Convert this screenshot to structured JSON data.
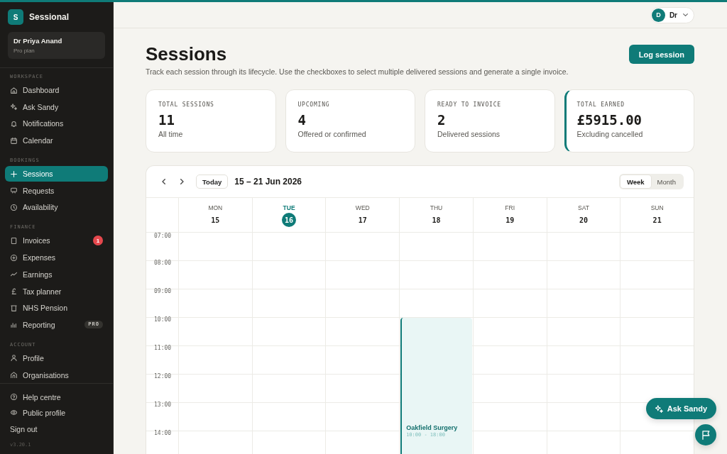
{
  "brand": {
    "logo_letter": "S",
    "name": "Sessional"
  },
  "account": {
    "name": "Dr Priya Anand",
    "plan": "Pro plan"
  },
  "sidebar": {
    "sections": [
      {
        "title": "WORKSPACE",
        "items": [
          {
            "label": "Dashboard",
            "selected": false
          },
          {
            "label": "Ask Sandy",
            "selected": false
          },
          {
            "label": "Notifications",
            "selected": false
          },
          {
            "label": "Calendar",
            "selected": false
          }
        ]
      },
      {
        "title": "BOOKINGS",
        "items": [
          {
            "label": "Sessions",
            "selected": true
          },
          {
            "label": "Requests",
            "selected": false
          },
          {
            "label": "Availability",
            "selected": false
          }
        ]
      },
      {
        "title": "FINANCE",
        "items": [
          {
            "label": "Invoices",
            "selected": false,
            "badge": "1"
          },
          {
            "label": "Expenses",
            "selected": false
          },
          {
            "label": "Earnings",
            "selected": false
          },
          {
            "label": "Tax planner",
            "selected": false
          },
          {
            "label": "NHS Pension",
            "selected": false
          },
          {
            "label": "Reporting",
            "selected": false,
            "tag": "PRO"
          }
        ]
      },
      {
        "title": "ACCOUNT",
        "items": [
          {
            "label": "Profile",
            "selected": false
          },
          {
            "label": "Organisations",
            "selected": false
          }
        ]
      }
    ],
    "footer_links": [
      "Help centre",
      "Public profile"
    ],
    "sign_out": "Sign out",
    "version": "v3.20.1"
  },
  "top_bar": {
    "user_initial": "D",
    "user_label": "Dr"
  },
  "page": {
    "title": "Sessions",
    "subtitle": "Track each session through its lifecycle. Use the checkboxes to select multiple delivered sessions and generate a single invoice.",
    "primary_action": "Log session"
  },
  "stats": [
    {
      "label": "TOTAL SESSIONS",
      "value": "11",
      "caption": "All time",
      "highlighted": false
    },
    {
      "label": "UPCOMING",
      "value": "4",
      "caption": "Offered or confirmed",
      "highlighted": false
    },
    {
      "label": "READY TO INVOICE",
      "value": "2",
      "caption": "Delivered sessions",
      "highlighted": false
    },
    {
      "label": "TOTAL EARNED",
      "value": "£5915.00",
      "caption": "Excluding cancelled",
      "highlighted": true
    }
  ],
  "calendar": {
    "today_button": "Today",
    "range": "15 – 21 Jun 2026",
    "views": [
      {
        "label": "Week",
        "selected": true
      },
      {
        "label": "Month",
        "selected": false
      }
    ],
    "days": [
      {
        "name": "MON",
        "date": "15",
        "today": false
      },
      {
        "name": "TUE",
        "date": "16",
        "today": true
      },
      {
        "name": "WED",
        "date": "17",
        "today": false
      },
      {
        "name": "THU",
        "date": "18",
        "today": false,
        "events": [
          {
            "title": "Oakfield Surgery",
            "time": "10:00 - 18:00"
          }
        ]
      },
      {
        "name": "FRI",
        "date": "19",
        "today": false
      },
      {
        "name": "SAT",
        "date": "20",
        "today": false
      },
      {
        "name": "SUN",
        "date": "21",
        "today": false
      }
    ],
    "hours": [
      "07:00",
      "08:00",
      "09:00",
      "10:00",
      "11:00",
      "12:00",
      "13:00",
      "14:00"
    ]
  },
  "floating_actions": {
    "assistant_button": "Ask Sandy"
  }
}
